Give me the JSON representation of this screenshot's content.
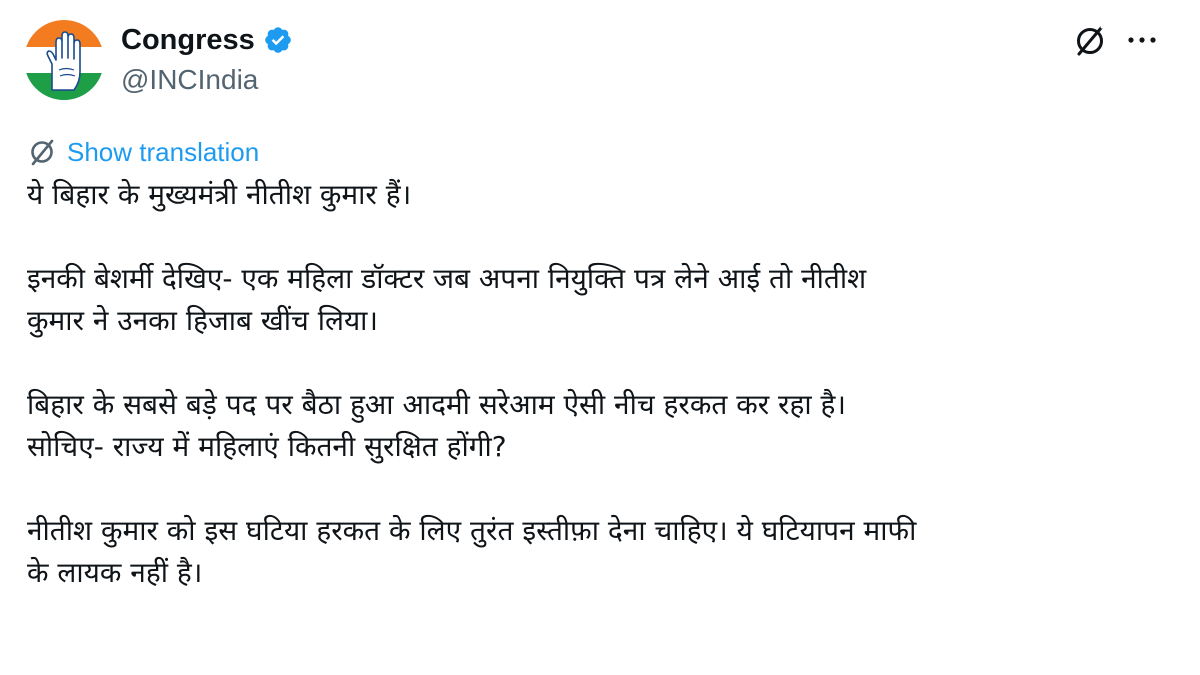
{
  "author": {
    "display_name": "Congress",
    "handle": "@INCIndia",
    "verified": true,
    "avatar_icon": "congress-hand-logo"
  },
  "actions": {
    "grok_icon": "grok-icon",
    "more_icon": "more-icon"
  },
  "translation": {
    "label": "Show translation"
  },
  "tweet": {
    "paragraphs": [
      {
        "lines": [
          "ये बिहार के मुख्यमंत्री नीतीश कुमार हैं।"
        ]
      },
      {
        "lines": [
          "इनकी बेशर्मी देखिए- एक महिला डॉक्टर जब अपना नियुक्ति पत्र लेने आई तो नीतीश",
          "कुमार ने उनका हिजाब खींच लिया।"
        ]
      },
      {
        "lines": [
          "बिहार के सबसे बड़े पद पर बैठा हुआ आदमी सरेआम ऐसी नीच हरकत कर रहा है।",
          "सोचिए- राज्य में महिलाएं कितनी सुरक्षित होंगी?"
        ]
      },
      {
        "lines": [
          "नीतीश कुमार को इस घटिया हरकत के लिए तुरंत इस्तीफ़ा देना चाहिए। ये घटियापन माफी",
          "के लायक नहीं है।"
        ]
      }
    ]
  },
  "colors": {
    "text_primary": "#0f1419",
    "text_secondary": "#536471",
    "link_blue": "#1d9bf0",
    "verified_blue": "#1d9bf0",
    "logo_saffron": "#f47c20",
    "logo_green": "#1f9e48"
  }
}
